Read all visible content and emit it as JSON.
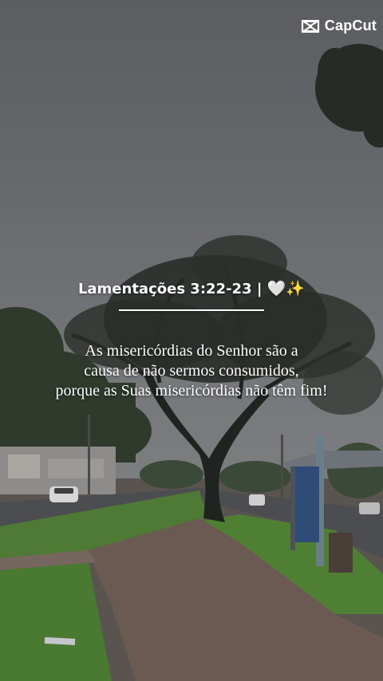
{
  "watermark": {
    "brand": "CapCut",
    "icon": "capcut-logo-icon"
  },
  "caption": {
    "title": "Lamentações 3:22-23 |",
    "title_emojis": "🤍✨",
    "verse_lines": [
      "As misericórdias do Senhor são a",
      "causa de não sermos consumidos,",
      "porque as Suas misericórdias não têm fim!"
    ]
  },
  "colors": {
    "text": "#ffffff",
    "sky": "#6a6c70",
    "grass": "#4f7a35",
    "path": "#6b5a52"
  }
}
